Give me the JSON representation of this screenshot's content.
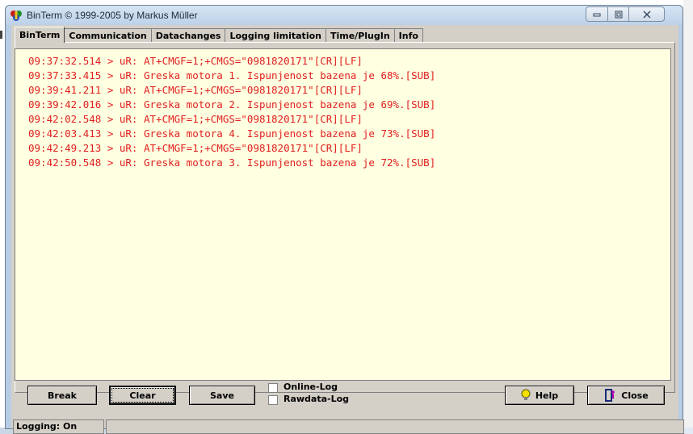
{
  "window": {
    "title": "BinTerm © 1999-2005 by Markus Müller",
    "controls": {
      "minimize": "▭",
      "maximize": "▢",
      "close": "✕"
    }
  },
  "tabs": [
    {
      "label": "BinTerm",
      "active": true
    },
    {
      "label": "Communication",
      "active": false
    },
    {
      "label": "Datachanges",
      "active": false
    },
    {
      "label": "Logging limitation",
      "active": false
    },
    {
      "label": "Time/PlugIn",
      "active": false
    },
    {
      "label": "Info",
      "active": false
    }
  ],
  "log": {
    "color": "#e02020",
    "lines": [
      "09:37:32.514 > uR: AT+CMGF=1;+CMGS=\"0981820171\"[CR][LF]",
      "09:37:33.415 > uR: Greska motora 1. Ispunjenost bazena je 68%.[SUB]",
      "09:39:41.211 > uR: AT+CMGF=1;+CMGS=\"0981820171\"[CR][LF]",
      "09:39:42.016 > uR: Greska motora 2. Ispunjenost bazena je 69%.[SUB]",
      "09:42:02.548 > uR: AT+CMGF=1;+CMGS=\"0981820171\"[CR][LF]",
      "09:42:03.413 > uR: Greska motora 4. Ispunjenost bazena je 73%.[SUB]",
      "09:42:49.213 > uR: AT+CMGF=1;+CMGS=\"0981820171\"[CR][LF]",
      "09:42:50.548 > uR: Greska motora 3. Ispunjenost bazena je 72%.[SUB]"
    ]
  },
  "buttons": {
    "break": "Break",
    "clear": "Clear",
    "save": "Save",
    "help": "Help",
    "close": "Close"
  },
  "checkboxes": {
    "online_log": {
      "label": "Online-Log",
      "checked": false
    },
    "rawdata_log": {
      "label": "Rawdata-Log",
      "checked": false
    }
  },
  "status": {
    "label": "Logging:",
    "value": "On"
  }
}
